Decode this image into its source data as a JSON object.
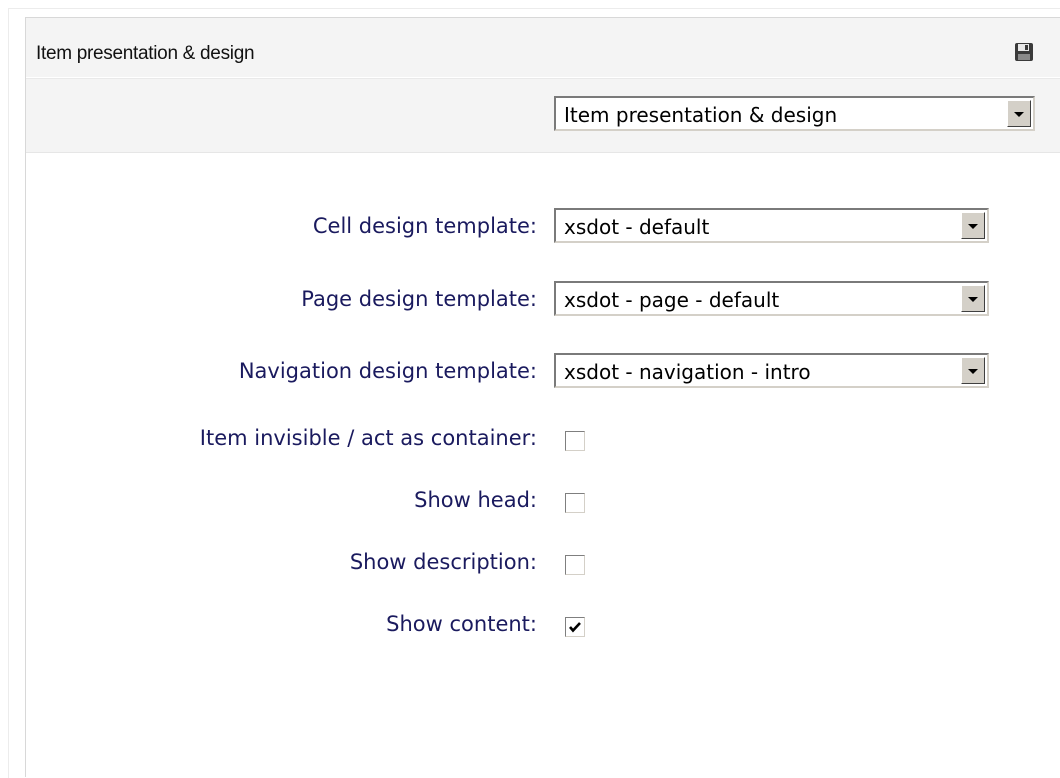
{
  "panel": {
    "title": "Item presentation & design",
    "save_icon": "floppy-disk-save-icon"
  },
  "toolbar": {
    "section_select": {
      "value": "Item presentation & design"
    }
  },
  "form": {
    "cell_design_template": {
      "label": "Cell design template:",
      "value": "xsdot - default"
    },
    "page_design_template": {
      "label": "Page design template:",
      "value": "xsdot - page - default"
    },
    "navigation_design_template": {
      "label": "Navigation design template:",
      "value": "xsdot - navigation - intro"
    },
    "item_invisible": {
      "label": "Item invisible / act as container:",
      "checked": false
    },
    "show_head": {
      "label": "Show head:",
      "checked": false
    },
    "show_description": {
      "label": "Show description:",
      "checked": false
    },
    "show_content": {
      "label": "Show content:",
      "checked": true
    }
  },
  "colors": {
    "label_text": "#1a1a5e",
    "header_bg": "#f4f4f4",
    "panel_border": "#d8d8d8"
  }
}
